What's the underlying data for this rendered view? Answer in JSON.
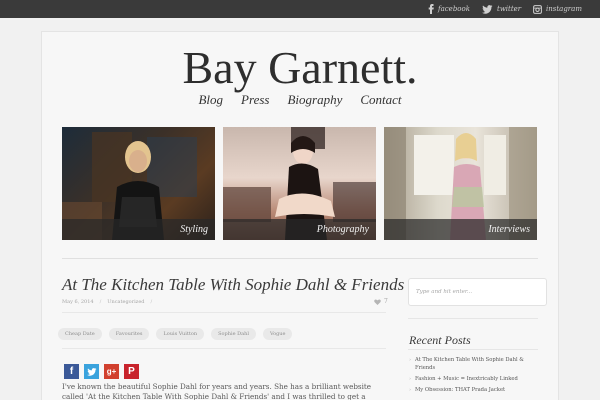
{
  "social": {
    "facebook": "facebook",
    "twitter": "twitter",
    "instagram": "instagram"
  },
  "site": {
    "title": "Bay Garnett."
  },
  "nav": [
    "Blog",
    "Press",
    "Biography",
    "Contact"
  ],
  "features": [
    {
      "caption": "Styling"
    },
    {
      "caption": "Photography"
    },
    {
      "caption": "Interviews"
    }
  ],
  "post": {
    "title": "At The Kitchen Table With Sophie Dahl & Friends",
    "date": "May 6, 2014",
    "category": "Uncategorized",
    "likes": "7",
    "tags": [
      "Cheap Date",
      "Favourites",
      "Louis Vuitton",
      "Sophie Dahl",
      "Vogue"
    ],
    "share": {
      "fb": "f",
      "tw": "t",
      "gp": "g+",
      "pin": "P"
    },
    "body": "I've known the beautiful Sophie Dahl for years and years.  She has a brilliant website called 'At the Kitchen Table With Sophie Dahl & Friends' and I was thrilled to get a chance to share some of my favourite things with"
  },
  "sidebar": {
    "search_placeholder": "Type and hit enter...",
    "recent_heading": "Recent Posts",
    "recent_posts": [
      "At The Kitchen Table With Sophie Dahl & Friends",
      "Fashion + Music = Inextricably Linked",
      "My Obsession: THAT Prada Jacket"
    ]
  },
  "colors": {
    "topbar": "#3a3a3a",
    "facebook": "#3b5998",
    "twitter": "#3aa3dd",
    "googleplus": "#d1402e",
    "pinterest": "#c8232c"
  }
}
